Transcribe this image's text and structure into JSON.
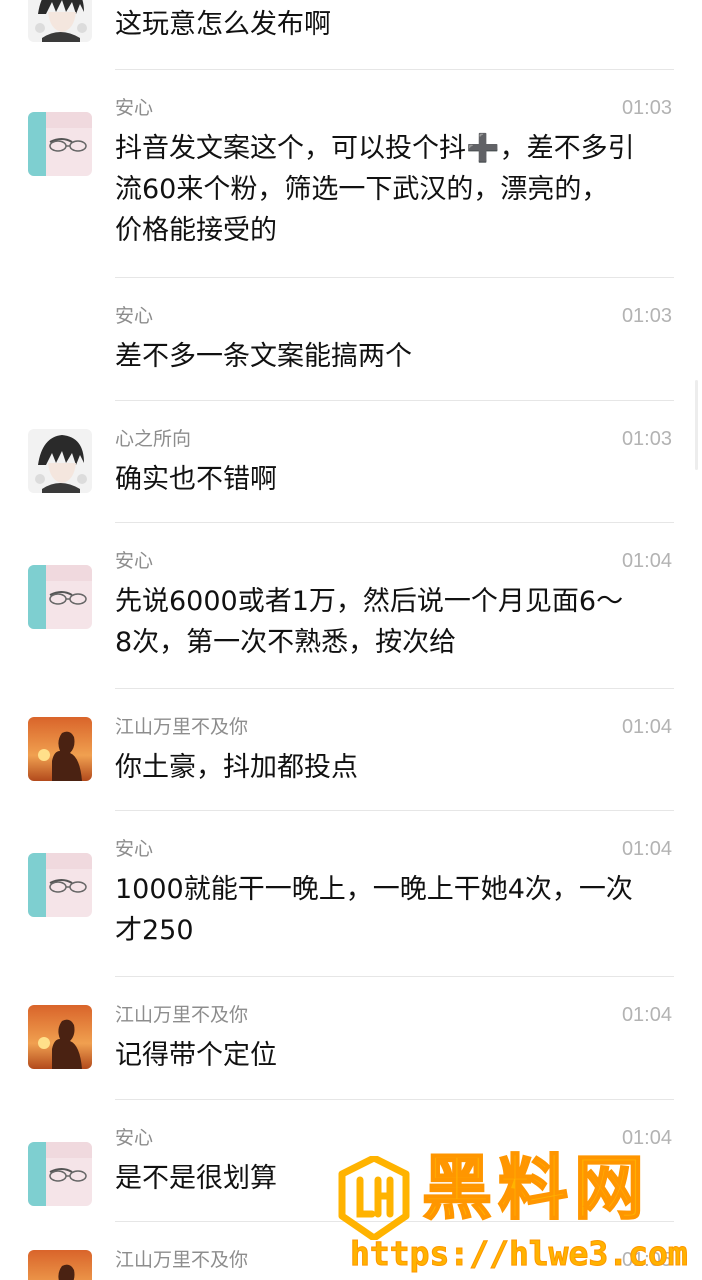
{
  "chat": {
    "messages": [
      {
        "sender": "",
        "time": "",
        "text": "这玩意怎么发布啊",
        "avatar": "anime-boy-avatar"
      },
      {
        "sender": "安心",
        "time": "01:03",
        "text": "抖音发文案这个，可以投个抖➕，差不多引\n流60来个粉，筛选一下武汉的，漂亮的，\n价格能接受的",
        "avatar": "glasses-face-avatar"
      },
      {
        "sender": "安心",
        "time": "01:03",
        "text": "差不多一条文案能搞两个",
        "avatar": ""
      },
      {
        "sender": "心之所向",
        "time": "01:03",
        "text": "确实也不错啊",
        "avatar": "anime-boy-avatar"
      },
      {
        "sender": "安心",
        "time": "01:04",
        "text": "先说6000或者1万，然后说一个月见面6～\n8次，第一次不熟悉，按次给",
        "avatar": "glasses-face-avatar"
      },
      {
        "sender": "江山万里不及你",
        "time": "01:04",
        "text": "你土豪，抖加都投点",
        "avatar": "sunset-avatar"
      },
      {
        "sender": "安心",
        "time": "01:04",
        "text": "1000就能干一晚上，一晚上干她4次，一次\n才250",
        "avatar": "glasses-face-avatar"
      },
      {
        "sender": "江山万里不及你",
        "time": "01:04",
        "text": "记得带个定位",
        "avatar": "sunset-avatar"
      },
      {
        "sender": "安心",
        "time": "01:04",
        "text": "是不是很划算",
        "avatar": "glasses-face-avatar"
      },
      {
        "sender": "江山万里不及你",
        "time": "01:05",
        "text": "",
        "avatar": "sunset-avatar"
      }
    ]
  },
  "watermark": {
    "title": "黑料网",
    "url": "https://hlwe3.com",
    "color": "#ffb300"
  }
}
